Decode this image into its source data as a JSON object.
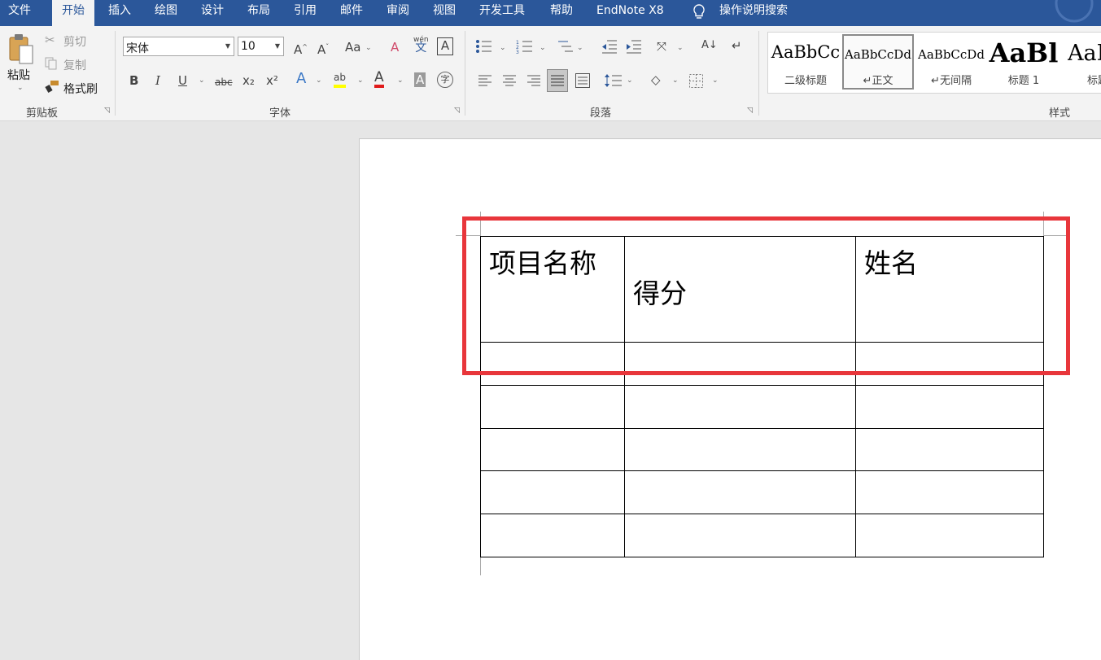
{
  "menu": {
    "tabs": [
      "文件",
      "开始",
      "插入",
      "绘图",
      "设计",
      "布局",
      "引用",
      "邮件",
      "审阅",
      "视图",
      "开发工具",
      "帮助",
      "EndNote X8"
    ],
    "active_tab": "开始",
    "search_text": "操作说明搜索"
  },
  "clipboard": {
    "paste": "粘贴",
    "cut": "剪切",
    "copy": "复制",
    "format_painter": "格式刷",
    "group": "剪贴板"
  },
  "font": {
    "name": "宋体",
    "size": "10",
    "group": "字体",
    "change_case": "Aa",
    "phonetic_top": "wén",
    "phonetic_bottom": "文",
    "border_char": "A",
    "bold": "B",
    "italic": "I",
    "underline": "U",
    "strike": "abc",
    "subscript": "x₂",
    "superscript": "x²",
    "effects": "A",
    "highlight": "ab",
    "font_color": "A",
    "shading": "A",
    "enclose": "字",
    "highlight_color": "#ffff00",
    "font_color_value": "#e01b1b"
  },
  "paragraph": {
    "group": "段落"
  },
  "styles": {
    "group": "样式",
    "items": [
      {
        "sample": "AaBbCc",
        "name": "二级标题"
      },
      {
        "sample": "AaBbCcDd",
        "name": "↵正文"
      },
      {
        "sample": "AaBbCcDd",
        "name": "↵无间隔"
      },
      {
        "sample": "AaBl",
        "name": "标题 1"
      },
      {
        "sample": "AaB",
        "name": "标题"
      }
    ]
  },
  "document": {
    "table": {
      "header": [
        "项目名称",
        "得分",
        "姓名"
      ],
      "empty_rows": 5
    },
    "highlight_color": "#e8363b"
  }
}
